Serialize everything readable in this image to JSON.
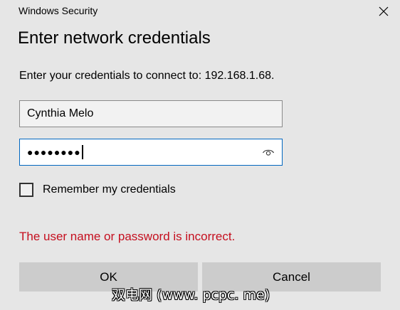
{
  "window": {
    "title": "Windows Security"
  },
  "dialog": {
    "heading": "Enter network credentials",
    "prompt": "Enter your credentials to connect to: 192.168.1.68.",
    "username_value": "Cynthia Melo",
    "password_masked": "●●●●●●●●",
    "remember_label": "Remember my credentials",
    "remember_checked": false,
    "error_message": "The user name or password is incorrect.",
    "error_color": "#c50f1f",
    "ok_label": "OK",
    "cancel_label": "Cancel"
  },
  "icons": {
    "close": "close-icon",
    "reveal": "eye-icon"
  },
  "watermark": {
    "text": "双电网 (www. pcpc. me)"
  }
}
